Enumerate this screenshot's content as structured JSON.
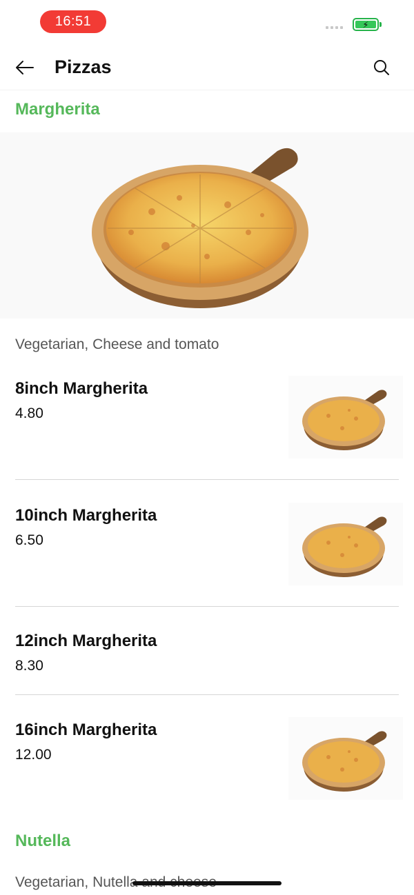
{
  "status_bar": {
    "time": "16:51"
  },
  "header": {
    "title": "Pizzas"
  },
  "sections": [
    {
      "title": "Margherita",
      "description": "Vegetarian, Cheese and tomato",
      "items": [
        {
          "name": "8inch Margherita",
          "price": "4.80"
        },
        {
          "name": "10inch Margherita",
          "price": "6.50"
        },
        {
          "name": "12inch Margherita",
          "price": "8.30"
        },
        {
          "name": "16inch Margherita",
          "price": "12.00"
        }
      ]
    },
    {
      "title": "Nutella",
      "description": "Vegetarian,  Nutella and cheese"
    }
  ],
  "colors": {
    "accent": "#55b85a",
    "time_pill": "#f23b35",
    "battery": "#35c759"
  },
  "icons": [
    "back-arrow-icon",
    "search-icon",
    "battery-icon",
    "signal-icon"
  ]
}
